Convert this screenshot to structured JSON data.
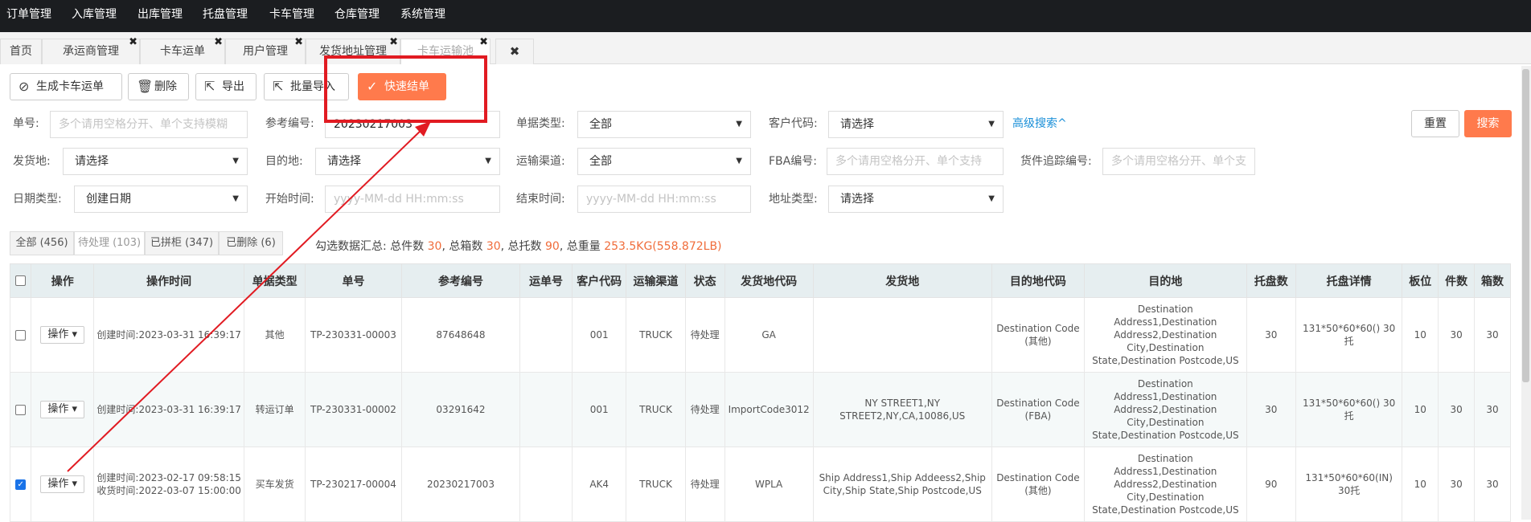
{
  "top_nav": [
    "订单管理",
    "入库管理",
    "出库管理",
    "托盘管理",
    "卡车管理",
    "仓库管理",
    "系统管理"
  ],
  "tabs": [
    {
      "label": "首页",
      "closable": false
    },
    {
      "label": "承运商管理",
      "closable": true
    },
    {
      "label": "卡车运单",
      "closable": true
    },
    {
      "label": "用户管理",
      "closable": true
    },
    {
      "label": "发货地址管理",
      "closable": true
    },
    {
      "label": "卡车运输池",
      "closable": true,
      "active": true
    }
  ],
  "tab_close_all": "✖",
  "toolbar": {
    "generate": "生成卡车运单",
    "delete": "删除",
    "export": "导出",
    "batch_import": "批量导入",
    "quick_close": "快速结单"
  },
  "filters": {
    "order_no_label": "单号:",
    "order_no_placeholder": "多个请用空格分开、单个支持模糊",
    "ref_no_label": "参考编号:",
    "ref_no_value": "20230217003",
    "doc_type_label": "单据类型:",
    "doc_type_value": "全部",
    "customer_code_label": "客户代码:",
    "customer_code_value": "请选择",
    "advanced_search": "高级搜索^",
    "reset": "重置",
    "search": "搜索",
    "origin_label": "发货地:",
    "origin_value": "请选择",
    "dest_label": "目的地:",
    "dest_value": "请选择",
    "channel_label": "运输渠道:",
    "channel_value": "全部",
    "fba_label": "FBA编号:",
    "fba_placeholder": "多个请用空格分开、单个支持",
    "tracking_label": "货件追踪编号:",
    "tracking_placeholder": "多个请用空格分开、单个支",
    "date_type_label": "日期类型:",
    "date_type_value": "创建日期",
    "start_label": "开始时间:",
    "start_placeholder": "yyyy-MM-dd HH:mm:ss",
    "end_label": "结束时间:",
    "end_placeholder": "yyyy-MM-dd HH:mm:ss",
    "addr_type_label": "地址类型:",
    "addr_type_value": "请选择"
  },
  "status_tabs": [
    "全部 (456)",
    "待处理 (103)",
    "已拼柜 (347)",
    "已删除 (6)"
  ],
  "summary": {
    "prefix": "勾选数据汇总: 总件数",
    "pieces": "30",
    "boxes_label": ", 总箱数",
    "boxes": "30",
    "pallets_label": ", 总托数",
    "pallets": "90",
    "weight_label": ", 总重量",
    "weight": "253.5KG(558.872LB)"
  },
  "table": {
    "headers": [
      "操作",
      "操作时间",
      "单据类型",
      "单号",
      "参考编号",
      "运单号",
      "客户代码",
      "运输渠道",
      "状态",
      "发货地代码",
      "发货地",
      "目的地代码",
      "目的地",
      "托盘数",
      "托盘详情",
      "板位",
      "件数",
      "箱数"
    ],
    "rows": [
      {
        "checked": false,
        "op": "操作",
        "time": "创建时间:2023-03-31 16:39:17",
        "type": "其他",
        "no": "TP-230331-00003",
        "ref": "87648648",
        "waybill": "",
        "customer": "001",
        "channel": "TRUCK",
        "status": "待处理",
        "origin_code": "GA",
        "origin": "",
        "dest_code": "Destination Code (其他)",
        "dest": "Destination Address1,Destination Address2,Destination City,Destination State,Destination Postcode,US",
        "pallets": "30",
        "pallet_detail": "131*50*60*60()  30托",
        "slots": "10",
        "pieces": "30",
        "boxes": "30"
      },
      {
        "checked": false,
        "op": "操作",
        "time": "创建时间:2023-03-31 16:39:17",
        "type": "转运订单",
        "no": "TP-230331-00002",
        "ref": "03291642",
        "waybill": "",
        "customer": "001",
        "channel": "TRUCK",
        "status": "待处理",
        "origin_code": "ImportCode3012",
        "origin": "NY STREET1,NY STREET2,NY,CA,10086,US",
        "dest_code": "Destination Code (FBA)",
        "dest": "Destination Address1,Destination Address2,Destination City,Destination State,Destination Postcode,US",
        "pallets": "30",
        "pallet_detail": "131*50*60*60()  30托",
        "slots": "10",
        "pieces": "30",
        "boxes": "30"
      },
      {
        "checked": true,
        "op": "操作",
        "time": "创建时间:2023-02-17 09:58:15 收货时间:2022-03-07 15:00:00",
        "type": "买车发货",
        "no": "TP-230217-00004",
        "ref": "20230217003",
        "waybill": "",
        "customer": "AK4",
        "channel": "TRUCK",
        "status": "待处理",
        "origin_code": "WPLA",
        "origin": "Ship Address1,Ship Addeess2,Ship City,Ship State,Ship Postcode,US",
        "dest_code": "Destination Code (其他)",
        "dest": "Destination Address1,Destination Address2,Destination City,Destination State,Destination Postcode,US",
        "pallets": "90",
        "pallet_detail": "131*50*60*60(IN)  30托",
        "slots": "10",
        "pieces": "30",
        "boxes": "30"
      }
    ]
  },
  "colors": {
    "accent": "#ff7a4c",
    "annotation": "#e11b22",
    "link": "#1a8fd8",
    "nav_bg": "#1b1d20"
  }
}
